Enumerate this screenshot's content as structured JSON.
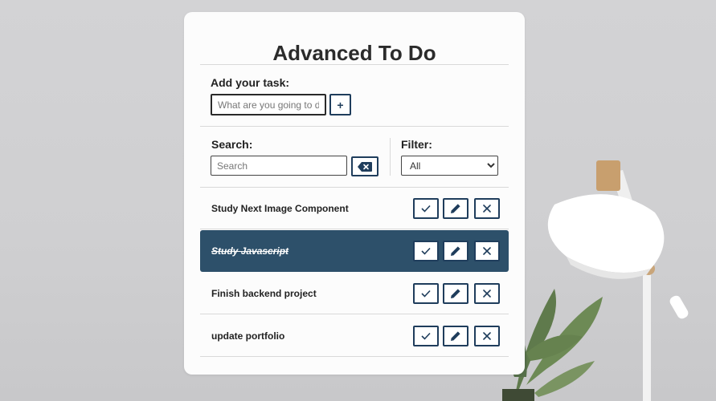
{
  "app": {
    "title": "Advanced To Do"
  },
  "add_task": {
    "label": "Add your task:",
    "placeholder": "What are you going to do",
    "add_button": "+"
  },
  "search": {
    "label": "Search:",
    "placeholder": "Search",
    "clear_icon": "backspace-icon"
  },
  "filter": {
    "label": "Filter:",
    "selected": "All",
    "options": [
      "All"
    ]
  },
  "tasks": [
    {
      "text": "Study Next Image Component",
      "completed": false
    },
    {
      "text": "Study Javascript",
      "completed": true
    },
    {
      "text": "Finish backend project",
      "completed": false
    },
    {
      "text": "update portfolio",
      "completed": false
    }
  ],
  "task_actions": {
    "complete_icon": "check-icon",
    "edit_icon": "pencil-icon",
    "delete_icon": "close-icon"
  },
  "colors": {
    "accent": "#1f3d5c",
    "completed_row": "#2d506a",
    "card": "#fcfcfc",
    "background": "#d0d0d2"
  }
}
